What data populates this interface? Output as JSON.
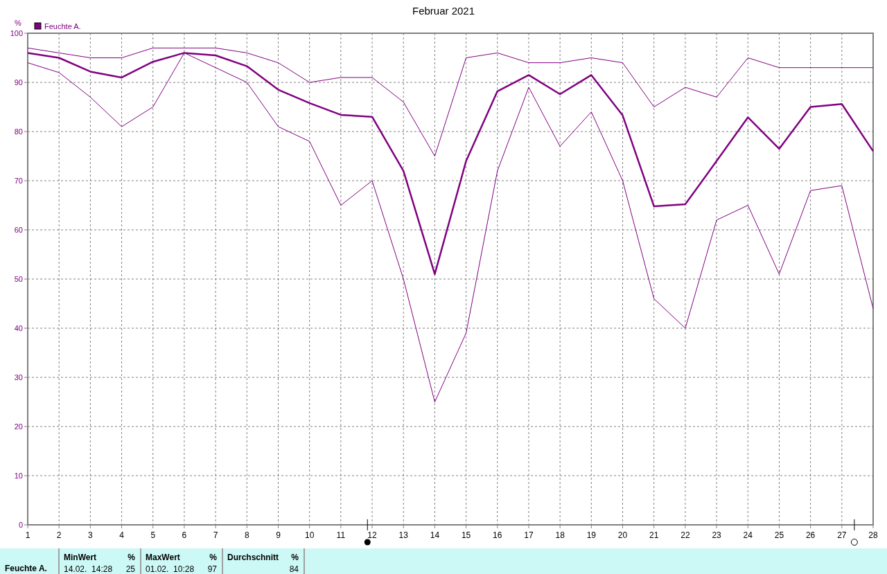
{
  "chart": {
    "title": "Februar 2021",
    "unit": "%",
    "axis_markers": [
      {
        "kind": "filled"
      },
      {
        "kind": "hollow"
      }
    ],
    "chart_data": {
      "type": "line",
      "x": [
        1,
        2,
        3,
        4,
        5,
        6,
        7,
        8,
        9,
        10,
        11,
        12,
        13,
        14,
        15,
        16,
        17,
        18,
        19,
        20,
        21,
        22,
        23,
        24,
        25,
        26,
        27,
        28
      ],
      "grid": true,
      "series": [
        {
          "name": "Feuchte A.",
          "color": "#800080",
          "values": [
            96,
            95,
            92.2,
            91,
            94.2,
            96,
            95.5,
            93.3,
            88.5,
            85.8,
            83.4,
            83,
            72,
            51,
            74,
            88.2,
            91.5,
            87.6,
            91.5,
            83.3,
            64.8,
            65.2,
            74,
            82.9,
            76.5,
            85,
            85.6,
            76
          ]
        },
        {
          "color": "#800080",
          "values": [
            97,
            96,
            95,
            95,
            97,
            97,
            97,
            96,
            94,
            90,
            91,
            91,
            86,
            75,
            95,
            96,
            94,
            94,
            95,
            94,
            85,
            89,
            87,
            95,
            93,
            93,
            93,
            93
          ]
        },
        {
          "color": "#800080",
          "values": [
            94,
            92,
            87,
            81,
            85,
            96,
            93,
            90,
            81,
            78,
            65,
            70,
            50,
            25,
            39,
            72,
            89,
            77,
            84,
            70,
            46,
            40,
            62,
            65,
            51,
            68,
            69,
            44
          ]
        }
      ],
      "xlim": [
        1,
        28
      ],
      "ylim": [
        0,
        100
      ],
      "xticks": [
        1,
        2,
        3,
        4,
        5,
        6,
        7,
        8,
        9,
        10,
        11,
        12,
        13,
        14,
        15,
        16,
        17,
        18,
        19,
        20,
        21,
        22,
        23,
        24,
        25,
        26,
        27,
        28
      ],
      "yticks": [
        0,
        10,
        20,
        30,
        40,
        50,
        60,
        70,
        80,
        90,
        100
      ]
    }
  },
  "table": {
    "row_label": "Feuchte A.",
    "columns": [
      {
        "header": "MinWert",
        "unit": "%",
        "when": "14.02.  14:28",
        "value": "25"
      },
      {
        "header": "MaxWert",
        "unit": "%",
        "when": "01.02.  10:28",
        "value": "97"
      },
      {
        "header": "Durchschnitt",
        "unit": "%",
        "value": "84"
      }
    ]
  }
}
